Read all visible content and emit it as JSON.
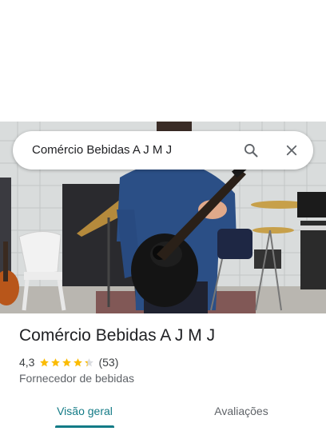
{
  "search": {
    "query": "Comércio Bebidas A J M J",
    "search_icon": "search-icon",
    "clear_icon": "close-icon"
  },
  "hero_image": {
    "description_icon": "photo"
  },
  "place": {
    "name": "Comércio Bebidas A J M J",
    "rating": "4,3",
    "rating_value": 4.3,
    "review_count": "(53)",
    "category": "Fornecedor de bebidas"
  },
  "tabs": [
    {
      "label": "Visão geral",
      "active": true
    },
    {
      "label": "Avaliações",
      "active": false
    }
  ],
  "colors": {
    "accent": "#137b86",
    "star": "#fbbc04",
    "star_empty": "#dadce0"
  }
}
